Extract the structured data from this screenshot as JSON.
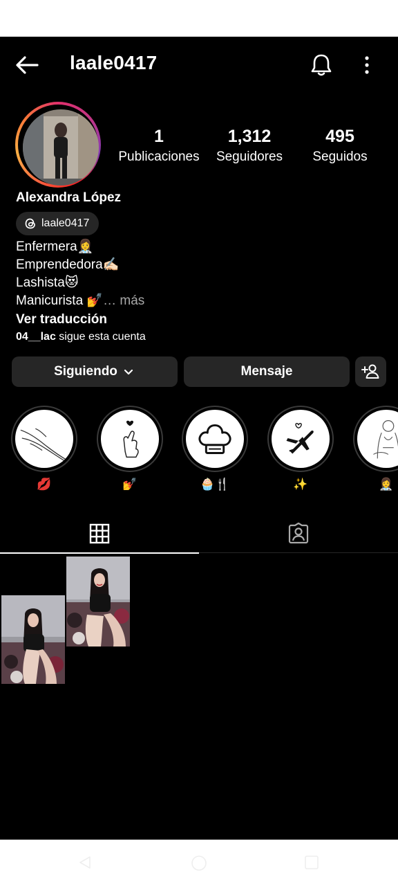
{
  "header": {
    "username": "laale0417"
  },
  "profile": {
    "full_name": "Alexandra López",
    "threads_handle": "laale0417",
    "stats": [
      {
        "value": "1",
        "label": "Publicaciones"
      },
      {
        "value": "1,312",
        "label": "Seguidores"
      },
      {
        "value": "495",
        "label": "Seguidos"
      }
    ],
    "bio": [
      "Enfermera👩‍⚕️",
      "Emprendedora✍🏻",
      "Lashista😻",
      "Manicurista 💅"
    ],
    "bio_more": "… más",
    "translate_label": "Ver traducción",
    "followed_by_user": "04__lac",
    "followed_by_text": " sigue esta cuenta"
  },
  "actions": {
    "following_label": "Siguiendo",
    "message_label": "Mensaje"
  },
  "highlights": [
    {
      "label": "💋",
      "icon": "hands-drawing-icon"
    },
    {
      "label": "💅",
      "icon": "finger-heart-icon"
    },
    {
      "label": "🧁🍴",
      "icon": "chef-hat-icon"
    },
    {
      "label": "✨",
      "icon": "airplane-icon"
    },
    {
      "label": "👩‍⚕️",
      "icon": "nurse-drawing-icon"
    }
  ],
  "tabs": [
    {
      "name": "grid",
      "icon": "grid-icon",
      "active": true
    },
    {
      "name": "tagged",
      "icon": "tagged-person-icon",
      "active": false
    }
  ],
  "colors": {
    "background": "#000000",
    "button": "#262626",
    "muted": "#a8a8a8"
  }
}
